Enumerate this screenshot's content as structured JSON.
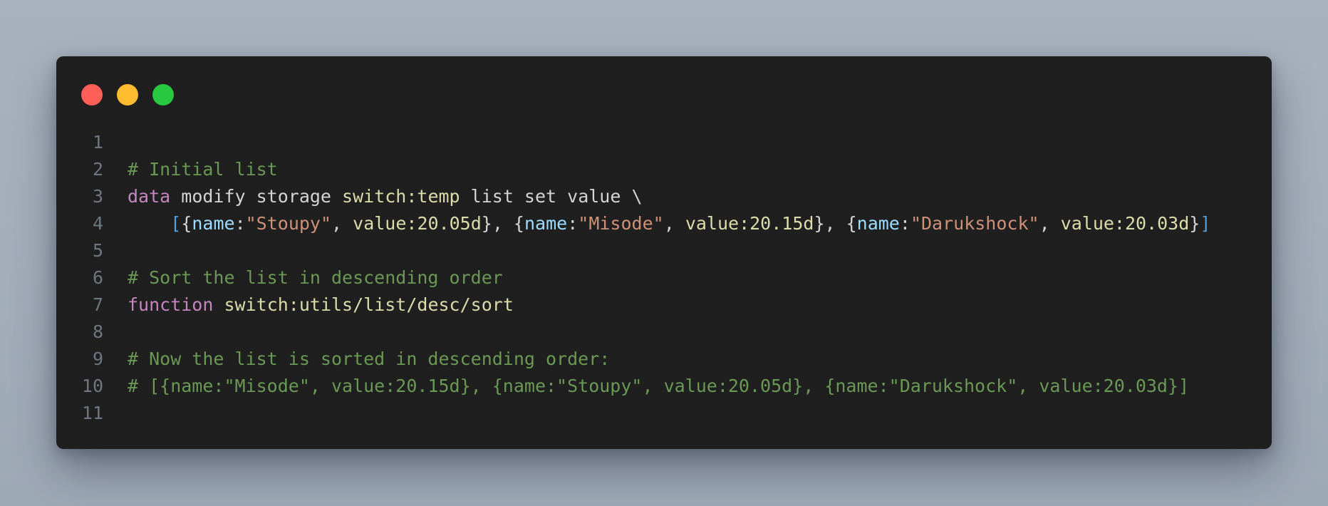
{
  "window": {
    "controls": [
      {
        "name": "close",
        "color": "#ff5f57"
      },
      {
        "name": "minimize",
        "color": "#febc2e"
      },
      {
        "name": "maximize",
        "color": "#28c840"
      }
    ]
  },
  "colors": {
    "comment": "#6a9955",
    "command": "#c586c0",
    "resource": "#dcdcaa",
    "key": "#9cdcfe",
    "string": "#ce9178",
    "plain": "#d4d4d4",
    "bracket": "#569cd6"
  },
  "code": {
    "lines": [
      {
        "number": "1",
        "tokens": []
      },
      {
        "number": "2",
        "tokens": [
          {
            "type": "comment",
            "text": "# Initial list"
          }
        ]
      },
      {
        "number": "3",
        "tokens": [
          {
            "type": "cmd",
            "text": "data"
          },
          {
            "type": "plain",
            "text": " modify storage "
          },
          {
            "type": "resloc",
            "text": "switch:temp"
          },
          {
            "type": "plain",
            "text": " list set value \\"
          }
        ]
      },
      {
        "number": "4",
        "tokens": [
          {
            "type": "plain",
            "text": "    "
          },
          {
            "type": "bracket",
            "text": "["
          },
          {
            "type": "plain",
            "text": "{"
          },
          {
            "type": "key",
            "text": "name"
          },
          {
            "type": "plain",
            "text": ":"
          },
          {
            "type": "string",
            "text": "\"Stoupy\""
          },
          {
            "type": "plain",
            "text": ", "
          },
          {
            "type": "resloc",
            "text": "value:20.05d"
          },
          {
            "type": "plain",
            "text": "}, {"
          },
          {
            "type": "key",
            "text": "name"
          },
          {
            "type": "plain",
            "text": ":"
          },
          {
            "type": "string",
            "text": "\"Misode\""
          },
          {
            "type": "plain",
            "text": ", "
          },
          {
            "type": "resloc",
            "text": "value:20.15d"
          },
          {
            "type": "plain",
            "text": "}, {"
          },
          {
            "type": "key",
            "text": "name"
          },
          {
            "type": "plain",
            "text": ":"
          },
          {
            "type": "string",
            "text": "\"Darukshock\""
          },
          {
            "type": "plain",
            "text": ", "
          },
          {
            "type": "resloc",
            "text": "value:20.03d"
          },
          {
            "type": "plain",
            "text": "}"
          },
          {
            "type": "bracket",
            "text": "]"
          }
        ]
      },
      {
        "number": "5",
        "tokens": []
      },
      {
        "number": "6",
        "tokens": [
          {
            "type": "comment",
            "text": "# Sort the list in descending order"
          }
        ]
      },
      {
        "number": "7",
        "tokens": [
          {
            "type": "cmd",
            "text": "function"
          },
          {
            "type": "plain",
            "text": " "
          },
          {
            "type": "resloc",
            "text": "switch:utils/list/desc/sort"
          }
        ]
      },
      {
        "number": "8",
        "tokens": []
      },
      {
        "number": "9",
        "tokens": [
          {
            "type": "comment",
            "text": "# Now the list is sorted in descending order:"
          }
        ]
      },
      {
        "number": "10",
        "tokens": [
          {
            "type": "comment",
            "text": "# [{name:\"Misode\", value:20.15d}, {name:\"Stoupy\", value:20.05d}, {name:\"Darukshock\", value:20.03d}]"
          }
        ]
      },
      {
        "number": "11",
        "tokens": []
      }
    ]
  }
}
